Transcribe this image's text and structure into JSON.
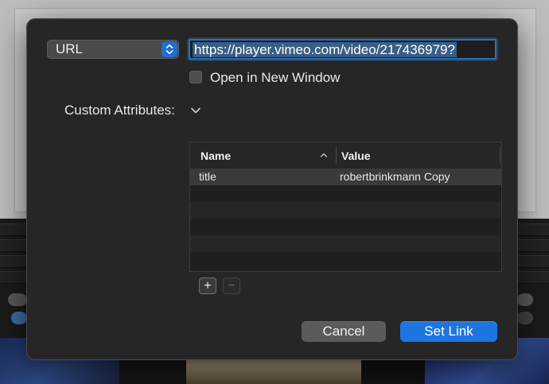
{
  "dialog": {
    "link_type": {
      "selected": "URL"
    },
    "url_field": {
      "value": "https://player.vimeo.com/video/217436979?"
    },
    "open_new_window": {
      "label": "Open in New Window",
      "checked": false
    },
    "custom_attributes": {
      "label": "Custom Attributes:",
      "columns": [
        "Name",
        "Value"
      ],
      "rows": [
        {
          "name": "title",
          "value": "robertbrinkmann Copy"
        }
      ],
      "add_label": "+",
      "remove_label": "−"
    },
    "cancel_label": "Cancel",
    "set_link_label": "Set Link"
  },
  "colors": {
    "accent": "#1f75e0",
    "sheet_bg": "#262626",
    "selection": "#3a5e86"
  }
}
